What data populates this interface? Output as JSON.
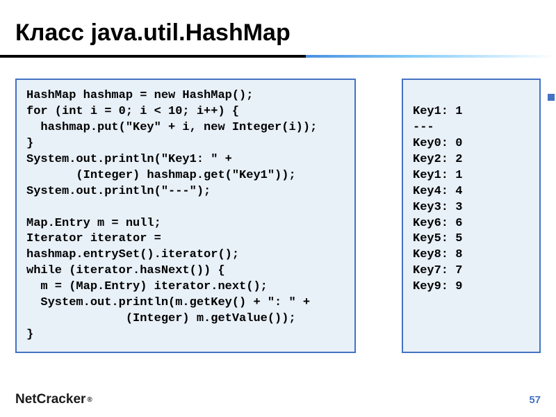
{
  "slide": {
    "title": "Класс java.util.HashMap",
    "code_left": "HashMap hashmap = new HashMap();\nfor (int i = 0; i < 10; i++) {\n  hashmap.put(\"Key\" + i, new Integer(i));\n}\nSystem.out.println(\"Key1: \" +\n       (Integer) hashmap.get(\"Key1\"));\nSystem.out.println(\"---\");\n\nMap.Entry m = null;\nIterator iterator =\nhashmap.entrySet().iterator();\nwhile (iterator.hasNext()) {\n  m = (Map.Entry) iterator.next();\n  System.out.println(m.getKey() + \": \" +\n              (Integer) m.getValue());\n}",
    "code_right": "\nKey1: 1\n---\nKey0: 0\nKey2: 2\nKey1: 1\nKey4: 4\nKey3: 3\nKey6: 6\nKey5: 5\nKey8: 8\nKey7: 7\nKey9: 9",
    "page_number": "57",
    "logo": {
      "part1": "Net",
      "part2": "Cracker",
      "reg": "®"
    }
  }
}
